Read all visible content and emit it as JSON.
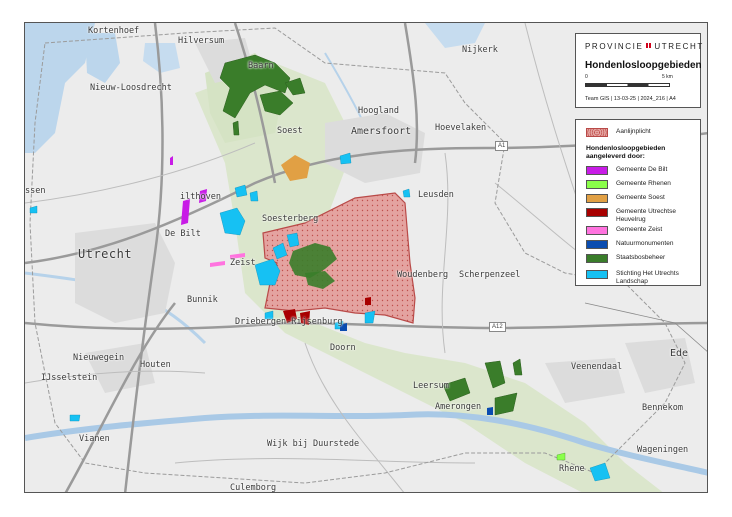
{
  "title_box": {
    "org_left": "PROVINCIE",
    "org_right": "UTRECHT",
    "map_title": "Hondenlosloopgebieden",
    "scale_start": "0",
    "scale_end": "5 km",
    "credits": "Team GIS | 13-03-25 | 2024_216 | A4"
  },
  "legend": {
    "outline_label": "Aanlijnplicht",
    "heading": "Hondenlosloopgebieden aangeleverd door:",
    "items": [
      {
        "label": "Gemeente De Bilt",
        "color": "#c81ce6"
      },
      {
        "label": "Gemeente Rhenen",
        "color": "#8aff4a"
      },
      {
        "label": "Gemeente Soest",
        "color": "#e1a044"
      },
      {
        "label": "Gemeente Utrechtse Heuvelrug",
        "color": "#a80000"
      },
      {
        "label": "Gemeente Zeist",
        "color": "#ff73df"
      },
      {
        "label": "Natuurmonumenten",
        "color": "#0a4cb0"
      },
      {
        "label": "Staatsbosbeheer",
        "color": "#3a7d2a"
      },
      {
        "label": "Stichting Het Utrechts Landschap",
        "color": "#16c1f3"
      }
    ],
    "outline_color": "#d9534f"
  },
  "places": {
    "kortenhoef": "Kortenhoef",
    "hilversum": "Hilversum",
    "baarn": "Baarn",
    "nijkerk": "Nijkerk",
    "nieuw_loosdrecht": "Nieuw-Loosdrecht",
    "hoogland": "Hoogland",
    "soest": "Soest",
    "amersfoort": "Amersfoort",
    "hoevelaken": "Hoevelaken",
    "leusden": "Leusden",
    "maarssen": "ssen",
    "bilthoven": "ilthoven",
    "soesterberg": "Soesterberg",
    "de_bilt": "De Bilt",
    "utrecht": "Utrecht",
    "zeist": "Zeist",
    "woudenberg": "Woudenberg",
    "scherpenzeel": "Scherpenzeel",
    "bunnik": "Bunnik",
    "driebergen": "Driebergen-Rijsenburg",
    "doorn": "Doorn",
    "ede": "Ede",
    "nieuwegein": "Nieuwegein",
    "ijsselstein": "IJsselstein",
    "houten": "Houten",
    "veenendaal": "Veenendaal",
    "leersum": "Leersum",
    "amerongen": "Amerongen",
    "bennekom": "Bennekom",
    "vianen": "Vianen",
    "wijk_bij_duurstede": "Wijk bij Duurstede",
    "wageningen": "Wageningen",
    "rhenen": "Rhene",
    "culemborg": "Culemborg"
  },
  "roads": {
    "a1_north": "A1",
    "a1_east": "A1",
    "a12": "A12"
  }
}
